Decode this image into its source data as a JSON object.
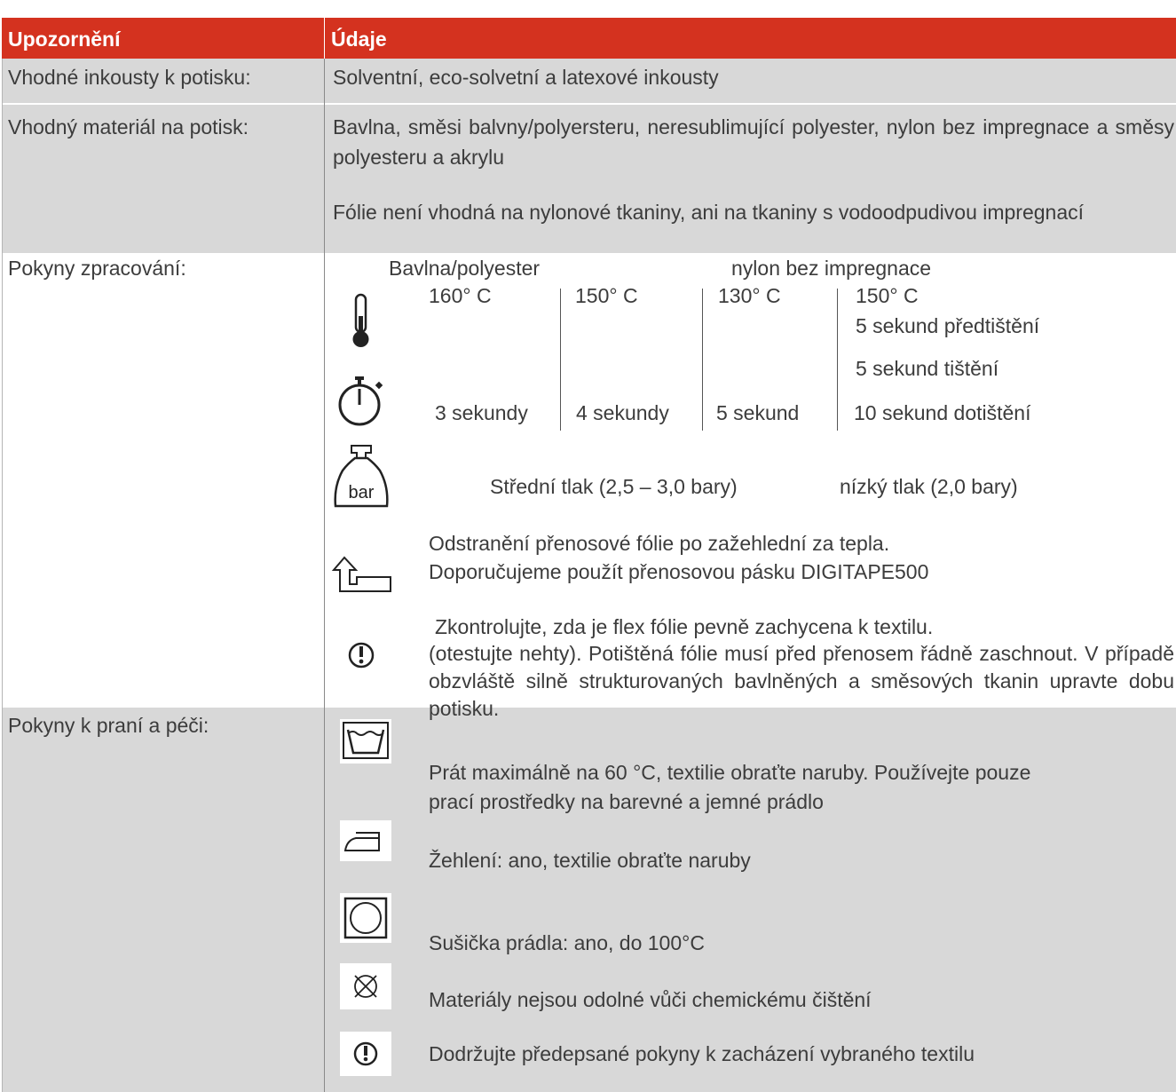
{
  "header": {
    "col1": "Upozornění",
    "col2": "Údaje"
  },
  "inks": {
    "label": "Vhodné inkousty k potisku:",
    "value": "Solventní, eco-solvetní a latexové inkousty"
  },
  "material": {
    "label": "Vhodný materiál na potisk:",
    "p1": "Bavlna, směsi balvny/polyersteru, neresublimující polyester, nylon bez impregnace a směsy polyesteru a akrylu",
    "p2": "Fólie není vhodná na nylonové tkaniny, ani na tkaniny s vodoodpudivou impregnací"
  },
  "processing": {
    "label": "Pokyny zpracování:",
    "group1": "Bavlna/polyester",
    "group2": "nylon bez impregnace",
    "temps": [
      "160° C",
      "150° C",
      "130° C",
      "150° C"
    ],
    "pre": "5 sekund předtištění",
    "print": "5 sekund tištění",
    "times": [
      "3 sekundy",
      "4 sekundy",
      "5 sekund",
      "10 sekund dotištění"
    ],
    "pressure1": "Střední tlak (2,5 – 3,0 bary)",
    "pressure2": "nízký tlak (2,0 bary)",
    "weight_label": "bar",
    "peel1": "Odstranění přenosové fólie po zažehlední za tepla.",
    "peel2": "Doporučujeme použít přenosovou pásku DIGITAPE500",
    "check1": "Zkontrolujte, zda je flex fólie pevně zachycena k textilu.",
    "check2": "(otestujte nehty). Potištěná fólie musí před přenosem řádně zaschnout. V případě obzvláště silně strukturovaných bavlněných a směsových tkanin upravte dobu potisku."
  },
  "care": {
    "label": "Pokyny k praní a péči:",
    "wash1": "Prát maximálně na 60 °C, textilie obraťte naruby. Používejte pouze",
    "wash2": "prací prostředky na barevné a jemné prádlo",
    "iron": "Žehlení: ano, textilie obraťte naruby",
    "dry": "Sušička prádla: ano, do 100°C",
    "chem": "Materiály nejsou odolné vůči chemickému čištění",
    "follow": "Dodržujte předepsané pokyny k zacházení vybraného textilu"
  },
  "icons": {
    "thermometer": "thermometer-icon",
    "stopwatch": "stopwatch-icon",
    "weight": "weight-bar-icon",
    "peel": "peel-arrow-icon",
    "warning": "exclamation-circle-icon",
    "wash": "wash-tub-icon",
    "iron": "iron-icon",
    "dryer": "tumble-dryer-icon",
    "no_dryclean": "no-dry-clean-icon"
  },
  "colors": {
    "header": "#d4321f",
    "row_shade": "#d8d8d8",
    "text": "#3c3c3c"
  }
}
